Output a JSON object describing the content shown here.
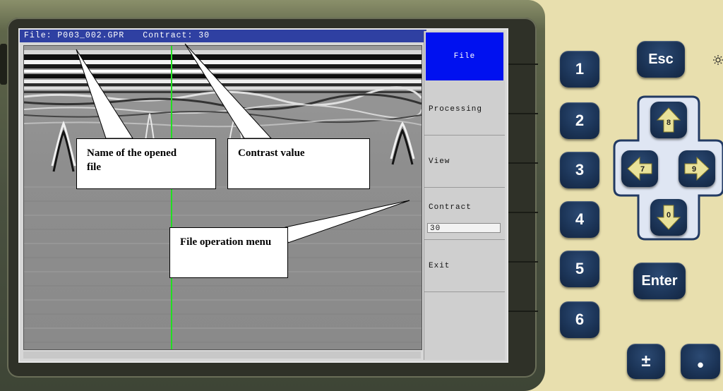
{
  "screen": {
    "title_file": "File: P003_002.GPR",
    "title_contrast": "Contract: 30"
  },
  "menu": {
    "items": [
      {
        "label": "File"
      },
      {
        "label": "Processing"
      },
      {
        "label": "View"
      },
      {
        "label": "Contract"
      },
      {
        "label": "Exit"
      }
    ],
    "contrast_value": "30"
  },
  "callouts": {
    "file_name": "Name of the opened file",
    "contrast": "Contrast value",
    "menu": "File operation menu"
  },
  "keypad": {
    "esc": "Esc",
    "enter": "Enter",
    "numbers": [
      "1",
      "2",
      "3",
      "4",
      "5",
      "6"
    ],
    "up": "8",
    "left": "7",
    "right": "9",
    "down": "0",
    "plusminus": "±",
    "dot": "•"
  },
  "colors": {
    "title_bar": "#2f40a2",
    "active_menu": "#0011f0",
    "cursor_line": "#22dd22",
    "key": "#1c3558",
    "arrow": "#e9e29a"
  }
}
